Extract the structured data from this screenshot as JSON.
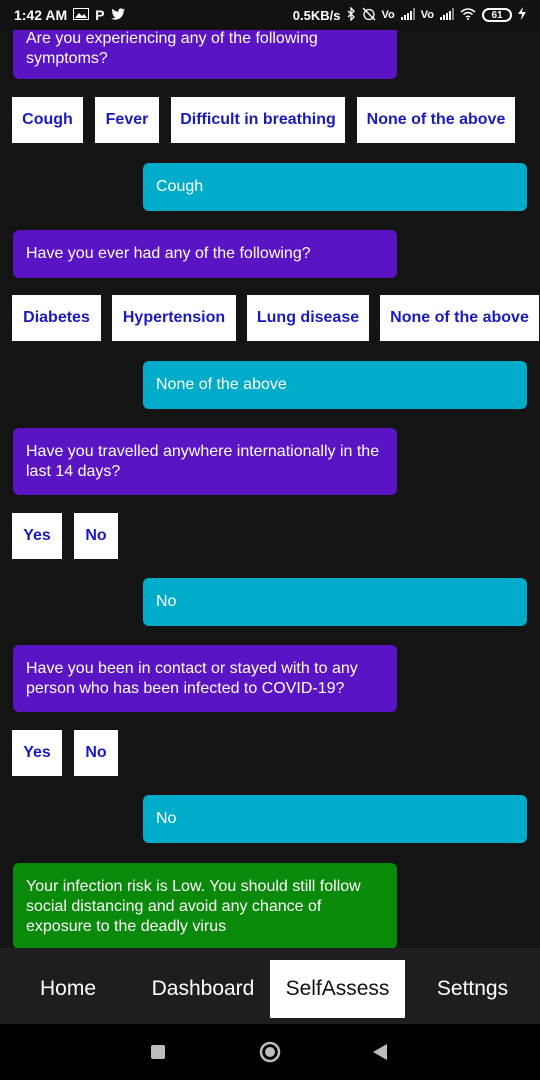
{
  "status_bar": {
    "time": "1:42 AM",
    "left_icons": [
      "gallery-icon",
      "p-icon",
      "twitter-icon"
    ],
    "left_glyphs": [
      "P"
    ],
    "network_speed": "0.5KB/s",
    "right_glyphs": [
      "Vo",
      "Vo"
    ],
    "battery": "61"
  },
  "chat": {
    "q1": "Are you experiencing any of the following symptoms?",
    "q1_options": [
      "Cough",
      "Fever",
      "Difficult in breathing",
      "None of the above"
    ],
    "a1": "Cough",
    "q2": "Have you ever had any of the following?",
    "q2_options": [
      "Diabetes",
      "Hypertension",
      "Lung disease",
      "None of the above"
    ],
    "a2": "None of the above",
    "q3": "Have you travelled anywhere internationally in the last 14 days?",
    "q3_options": [
      "Yes",
      "No"
    ],
    "a3": "No",
    "q4": "Have you been in contact or stayed with to any person who has been infected to COVID-19?",
    "q4_options": [
      "Yes",
      "No"
    ],
    "a4": "No",
    "result": "Your infection risk is Low. You should still follow social distancing and avoid any chance of exposure to the deadly virus"
  },
  "bottom_nav": {
    "items": [
      "Home",
      "Dashboard",
      "SelfAssess",
      "Settngs"
    ],
    "active": "SelfAssess"
  },
  "colors": {
    "question_bg": "#5a14c4",
    "answer_bg": "#00acc9",
    "result_bg": "#0a8a0a",
    "option_text": "#1a1bbb"
  },
  "system_nav": [
    "square-icon",
    "circle-icon",
    "back-triangle-icon"
  ]
}
